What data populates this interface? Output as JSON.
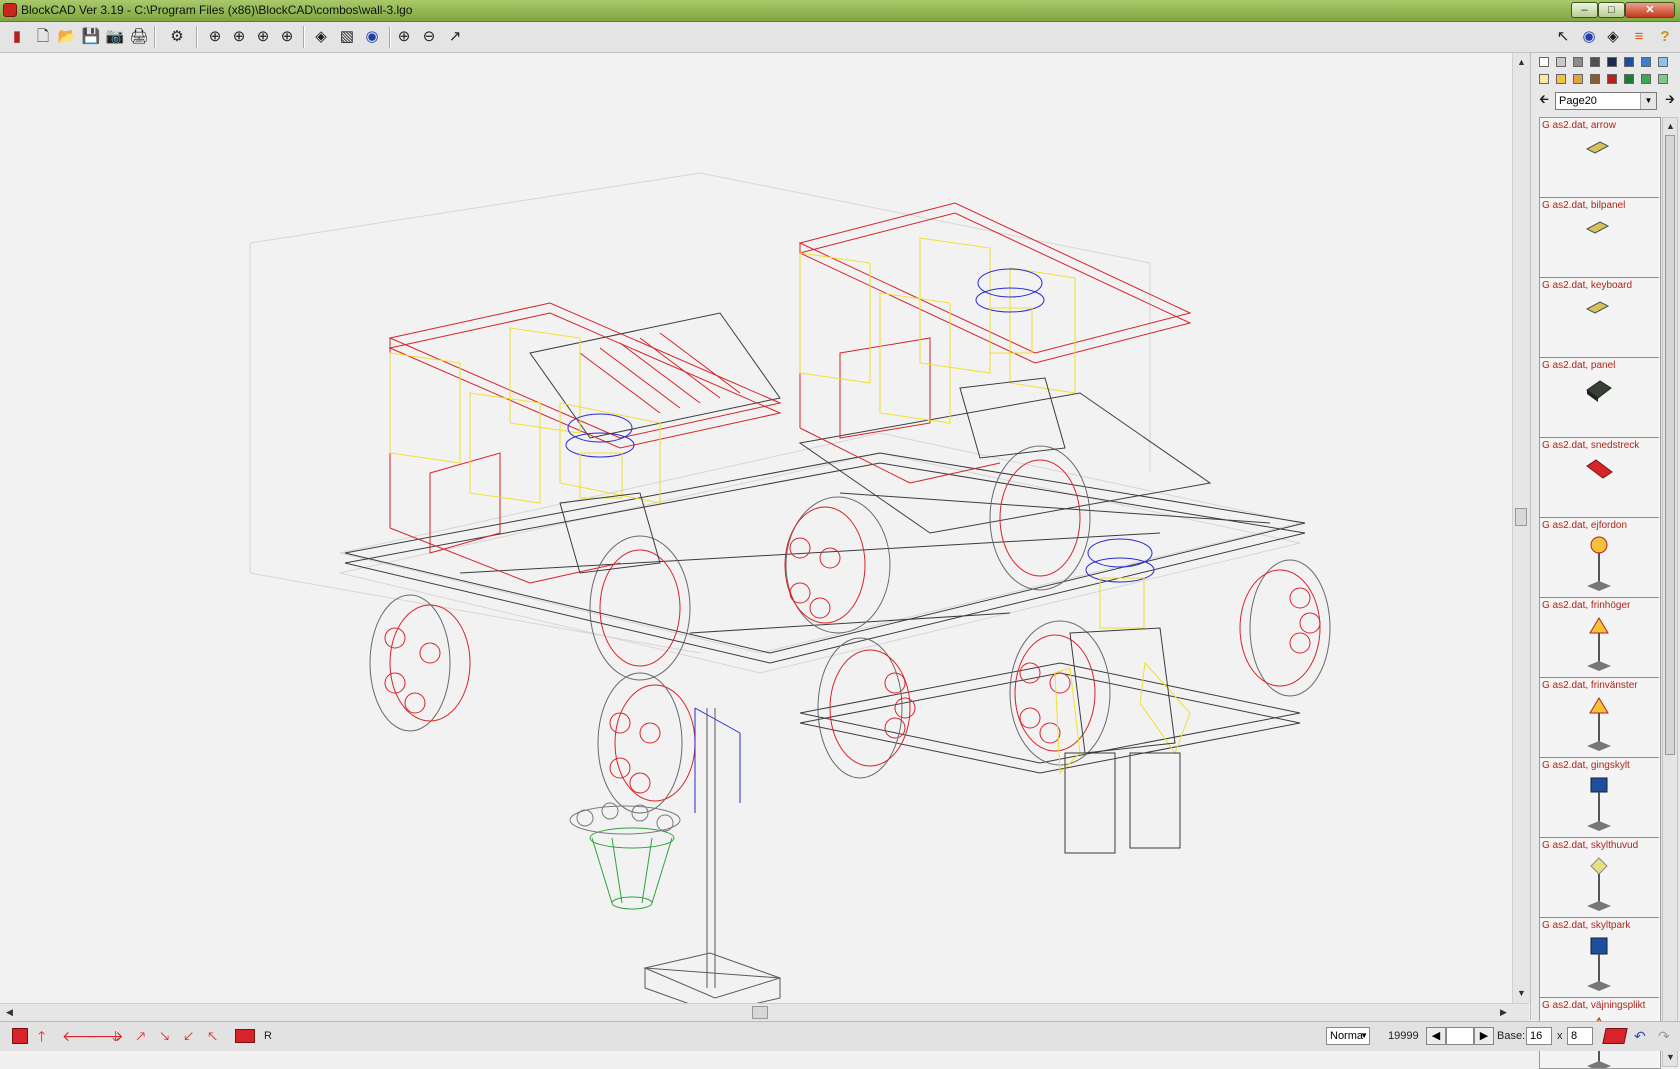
{
  "window": {
    "title": "BlockCAD Ver 3.19 - C:\\Program Files (x86)\\BlockCAD\\combos\\wall-3.lgo",
    "minimize_glyph": "–",
    "maximize_glyph": "□",
    "close_glyph": "✕"
  },
  "toolbar": [
    {
      "icon": "brick-icon",
      "glyph": "▮"
    },
    {
      "icon": "new-file-icon",
      "glyph": "🗋"
    },
    {
      "icon": "open-folder-icon",
      "glyph": "📂"
    },
    {
      "icon": "save-disk-icon",
      "glyph": "💾"
    },
    {
      "icon": "camera-icon",
      "glyph": "📷"
    },
    {
      "icon": "print-icon",
      "glyph": "🖨"
    },
    {
      "icon": "settings-gear-icon",
      "glyph": "⚙"
    },
    {
      "icon": "rotate-left-icon",
      "glyph": "⊕"
    },
    {
      "icon": "rotate-right-icon",
      "glyph": "⊕"
    },
    {
      "icon": "rotate-up-icon",
      "glyph": "⊕"
    },
    {
      "icon": "rotate-down-icon",
      "glyph": "⊕"
    },
    {
      "icon": "solid-view-icon",
      "glyph": "◈"
    },
    {
      "icon": "wireframe-view-icon",
      "glyph": "▧"
    },
    {
      "icon": "eye-view-icon",
      "glyph": "◉"
    },
    {
      "icon": "zoom-in-icon",
      "glyph": "⊕"
    },
    {
      "icon": "zoom-out-icon",
      "glyph": "⊖"
    },
    {
      "icon": "fit-view-icon",
      "glyph": "↗"
    }
  ],
  "right_tools": [
    {
      "icon": "select-arrow-icon",
      "glyph": "↖"
    },
    {
      "icon": "visibility-eye-icon",
      "glyph": "◉"
    },
    {
      "icon": "brick-view-icon",
      "glyph": "◈"
    },
    {
      "icon": "color-palette-icon",
      "glyph": "≡"
    },
    {
      "icon": "help-icon",
      "glyph": "?"
    }
  ],
  "palette": [
    "#ffffff",
    "#c8c8c8",
    "#8c8c8c",
    "#505050",
    "#1e2a4a",
    "#1f4e9c",
    "#3a7fd0",
    "#8fc1ee",
    "#f7e9a6",
    "#f2c23a",
    "#e3a33d",
    "#8c5a2e",
    "#b4241c",
    "#1e7a3a",
    "#3fa55a",
    "#7cc98a"
  ],
  "page_selector": {
    "value": "Page20",
    "prev_glyph": "🡰",
    "next_glyph": "🡲"
  },
  "parts": [
    {
      "label": "G as2.dat, arrow",
      "kind": "tile"
    },
    {
      "label": "G as2.dat, bilpanel",
      "kind": "tile"
    },
    {
      "label": "G as2.dat, keyboard",
      "kind": "tile"
    },
    {
      "label": "G as2.dat, panel",
      "kind": "panel"
    },
    {
      "label": "G as2.dat, snedstreck",
      "kind": "stripe"
    },
    {
      "label": "G as2.dat, ejfordon",
      "kind": "sign-round"
    },
    {
      "label": "G as2.dat, frinhöger",
      "kind": "sign-triangle"
    },
    {
      "label": "G as2.dat, frinvänster",
      "kind": "sign-triangle"
    },
    {
      "label": "G as2.dat, gingskylt",
      "kind": "sign-square-blue"
    },
    {
      "label": "G as2.dat, skylthuvud",
      "kind": "sign-diamond"
    },
    {
      "label": "G as2.dat, skyltpark",
      "kind": "sign-parking"
    },
    {
      "label": "G as2.dat, väjningsplikt",
      "kind": "sign-triangle"
    }
  ],
  "statusbar": {
    "r_label": "R",
    "mode": "Norma",
    "count": "19999",
    "base_label": "Base:",
    "base_x": "16",
    "x_label": "x",
    "base_y": "8"
  }
}
